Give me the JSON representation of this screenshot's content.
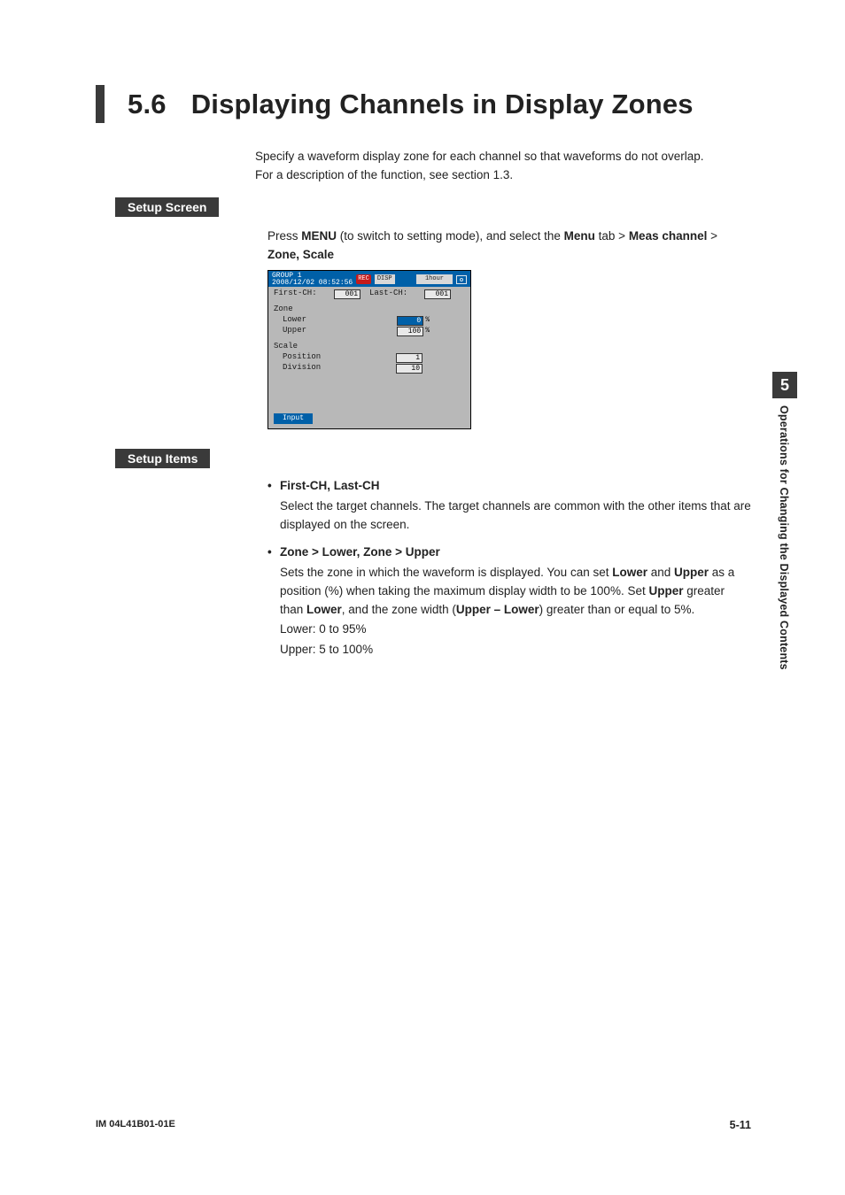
{
  "heading": {
    "number": "5.6",
    "title": "Displaying Channels in Display Zones"
  },
  "intro": {
    "line1": "Specify a waveform display zone for each channel so that waveforms do not overlap.",
    "line2": "For a description of the function, see section 1.3."
  },
  "setup_screen": {
    "label": "Setup Screen",
    "press": "Press ",
    "menu_bold": "MENU",
    "mid": " (to switch to setting mode), and select the ",
    "menu_tab": "Menu",
    "tab_word": " tab > ",
    "meas": "Meas channel",
    "gt": " > ",
    "zone_scale": "Zone, Scale"
  },
  "scr": {
    "group": "GROUP 1",
    "ts": "2008/12/02 08:52:56",
    "red": "REC",
    "disp": "DISP",
    "time": "1hour",
    "firstch_label": "First-CH:",
    "firstch_val": "001",
    "lastch_label": "Last-CH:",
    "lastch_val": "001",
    "zone_label": "Zone",
    "lower_label": "Lower",
    "lower_val": "0",
    "lower_unit": "%",
    "upper_label": "Upper",
    "upper_val": "100",
    "upper_unit": "%",
    "scale_label": "Scale",
    "position_label": "Position",
    "position_val": "1",
    "division_label": "Division",
    "division_val": "10",
    "input_btn": "Input"
  },
  "setup_items": {
    "label": "Setup Items",
    "item1": {
      "title": "First-CH, Last-CH",
      "text": "Select the target channels. The target channels are common with the other items that are displayed on the screen."
    },
    "item2": {
      "title": "Zone > Lower, Zone > Upper",
      "pre": "Sets the zone in which the waveform is displayed. You can set ",
      "lower_b": "Lower",
      "mid1": " and ",
      "upper_b": "Upper",
      "mid2": " as a position (%) when taking the maximum display width to be 100%. Set ",
      "upper_b2": "Upper",
      "mid3": " greater than ",
      "lower_b2": "Lower",
      "mid4": ", and the zone width (",
      "ul_b": "Upper – Lower",
      "mid5": ") greater than or equal to 5%.",
      "lower_range": "Lower:  0 to 95%",
      "upper_range": "Upper:  5 to 100%"
    }
  },
  "side": {
    "chapter": "5",
    "title": "Operations for Changing the Displayed Contents"
  },
  "footer": {
    "doc": "IM 04L41B01-01E",
    "page": "5-11"
  }
}
